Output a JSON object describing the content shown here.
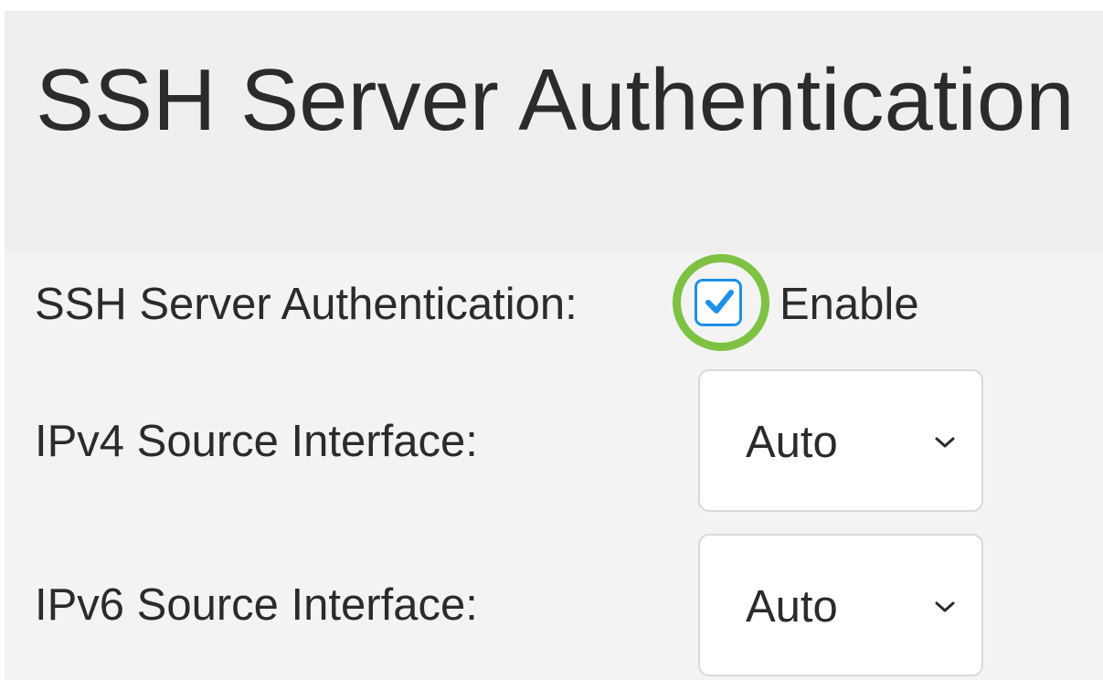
{
  "header": {
    "title": "SSH Server Authentication"
  },
  "form": {
    "ssh_auth": {
      "label": "SSH Server Authentication:",
      "checkbox_label": "Enable",
      "checked": true
    },
    "ipv4_source": {
      "label": "IPv4 Source Interface:",
      "selected": "Auto"
    },
    "ipv6_source": {
      "label": "IPv6 Source Interface:",
      "selected": "Auto"
    }
  },
  "colors": {
    "checkbox_accent": "#1e90e8",
    "highlight_ring": "#7dc242",
    "header_bg": "#efefef",
    "content_bg": "#f3f3f3"
  },
  "icons": {
    "checkbox_mark": "checkmark-icon",
    "select_arrow": "chevron-down-icon"
  }
}
